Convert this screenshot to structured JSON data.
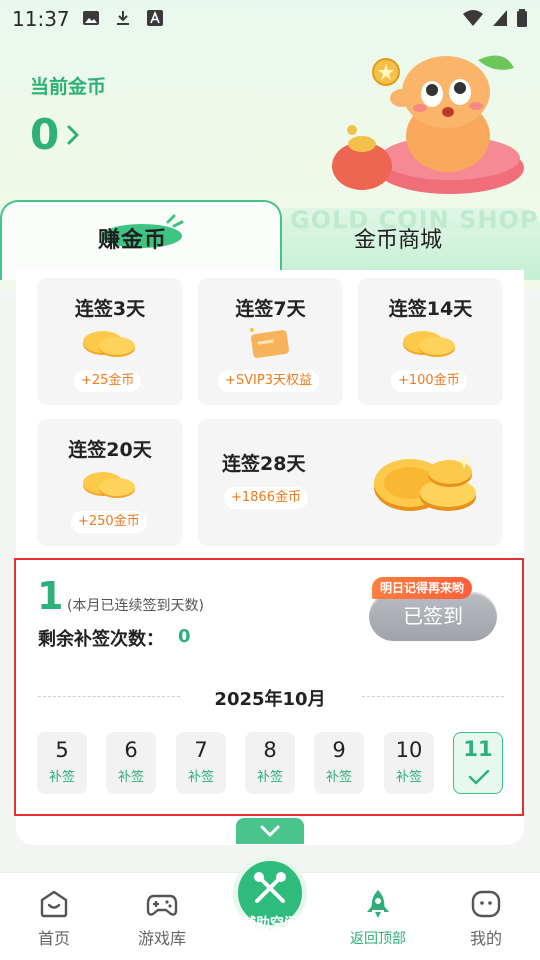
{
  "status_bar": {
    "time": "11:37"
  },
  "header": {
    "coin_label": "当前金币",
    "coin_value": "0"
  },
  "tabs": {
    "earn": "赚金币",
    "shop": "金币商城",
    "shop_watermark": "GOLD COIN SHOP"
  },
  "rewards": [
    {
      "title": "连签3天",
      "badge": "+25金币",
      "icon": "coins-icon"
    },
    {
      "title": "连签7天",
      "badge": "+SVIP3天权益",
      "icon": "vip-card-icon"
    },
    {
      "title": "连签14天",
      "badge": "+100金币",
      "icon": "coins-icon"
    },
    {
      "title": "连签20天",
      "badge": "+250金币",
      "icon": "coins-icon"
    },
    {
      "title": "连签28天",
      "badge": "+1866金币",
      "icon": "coin-pile-icon"
    }
  ],
  "checkin": {
    "streak_days": "1",
    "streak_text": "(本月已连续签到天数)",
    "remaining_label": "剩余补签次数：",
    "remaining_value": "0",
    "remind_tag": "明日记得再来哟",
    "signed_button": "已签到",
    "month": "2025年10月",
    "days": [
      {
        "num": "5",
        "tag": "补签"
      },
      {
        "num": "6",
        "tag": "补签"
      },
      {
        "num": "7",
        "tag": "补签"
      },
      {
        "num": "8",
        "tag": "补签"
      },
      {
        "num": "9",
        "tag": "补签"
      },
      {
        "num": "10",
        "tag": "补签"
      },
      {
        "num": "11",
        "tag": ""
      }
    ]
  },
  "bottom_nav": {
    "home": "首页",
    "games": "游戏库",
    "assist": "辅助空间",
    "top": "返回顶部",
    "mine": "我的"
  },
  "colors": {
    "accent": "#2db07a",
    "orange": "#f07a1c",
    "highlight_border": "#e0322f"
  }
}
